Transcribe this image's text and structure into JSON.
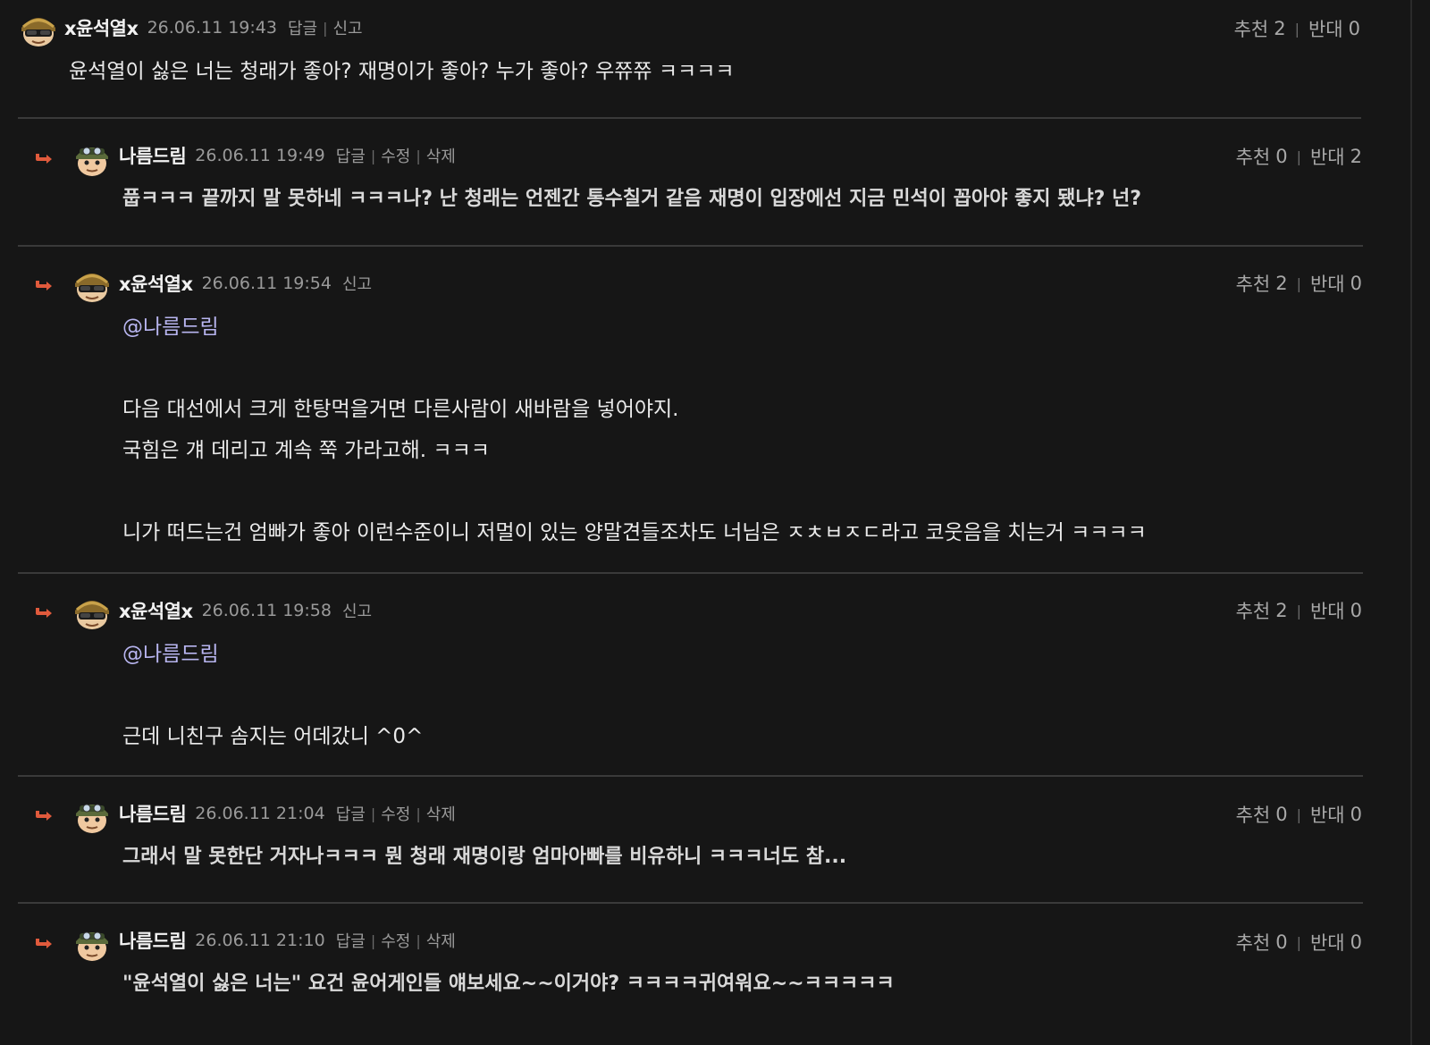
{
  "colors": {
    "background": "#161616",
    "mention": "#b8b5f0",
    "divider": "#3a3a3a",
    "reply_arrow": "#e05a3c"
  },
  "comments": [
    {
      "nick": "x윤석열x",
      "date": "26.06.11 19:43",
      "actions": [
        "답글",
        "신고"
      ],
      "upvote_label": "추천",
      "upvotes": "2",
      "downvote_label": "반대",
      "downvotes": "0",
      "lines": [
        "윤석열이 싫은 너는 청래가 좋아? 재명이가 좋아? 누가 좋아? 우쮸쮸 ㅋㅋㅋㅋ"
      ]
    },
    {
      "nick": "나름드림",
      "date": "26.06.11 19:49",
      "actions": [
        "답글",
        "수정",
        "삭제"
      ],
      "upvote_label": "추천",
      "upvotes": "0",
      "downvote_label": "반대",
      "downvotes": "2",
      "lines": [
        "풉ㅋㅋㅋ 끝까지 말 못하네 ㅋㅋㅋ나? 난 청래는 언젠간 통수칠거 같음 재명이 입장에선 지금 민석이 꼽아야 좋지 됐냐? 넌?"
      ]
    },
    {
      "nick": "x윤석열x",
      "date": "26.06.11 19:54",
      "actions": [
        "신고"
      ],
      "upvote_label": "추천",
      "upvotes": "2",
      "downvote_label": "반대",
      "downvotes": "0",
      "mention": "@나름드림",
      "lines": [
        "다음 대선에서 크게 한탕먹을거면 다른사람이 새바람을 넣어야지.",
        "국힘은 걔 데리고 계속 쭉 가라고해. ㅋㅋㅋ",
        "니가 떠드는건 엄빠가 좋아 이런수준이니 저멀이 있는 양말견들조차도 너님은 ㅈㅊㅂㅈㄷ라고 코웃음을 치는거 ㅋㅋㅋㅋ"
      ]
    },
    {
      "nick": "x윤석열x",
      "date": "26.06.11 19:58",
      "actions": [
        "신고"
      ],
      "upvote_label": "추천",
      "upvotes": "2",
      "downvote_label": "반대",
      "downvotes": "0",
      "mention": "@나름드림",
      "lines": [
        "근데 니친구 솜지는 어데갔니 ^0^"
      ]
    },
    {
      "nick": "나름드림",
      "date": "26.06.11 21:04",
      "actions": [
        "답글",
        "수정",
        "삭제"
      ],
      "upvote_label": "추천",
      "upvotes": "0",
      "downvote_label": "반대",
      "downvotes": "0",
      "lines": [
        "그래서 말 못한단 거자나ㅋㅋㅋ 뭔 청래 재명이랑 엄마아빠를 비유하니 ㅋㅋㅋ너도 참..."
      ]
    },
    {
      "nick": "나름드림",
      "date": "26.06.11 21:10",
      "actions": [
        "답글",
        "수정",
        "삭제"
      ],
      "upvote_label": "추천",
      "upvotes": "0",
      "downvote_label": "반대",
      "downvotes": "0",
      "lines": [
        "\"윤석열이 싫은 너는\" 요건 윤어게인들 얘보세요~~이거야? ㅋㅋㅋㅋ귀여워요~~ㅋㅋㅋㅋㅋ"
      ]
    }
  ]
}
